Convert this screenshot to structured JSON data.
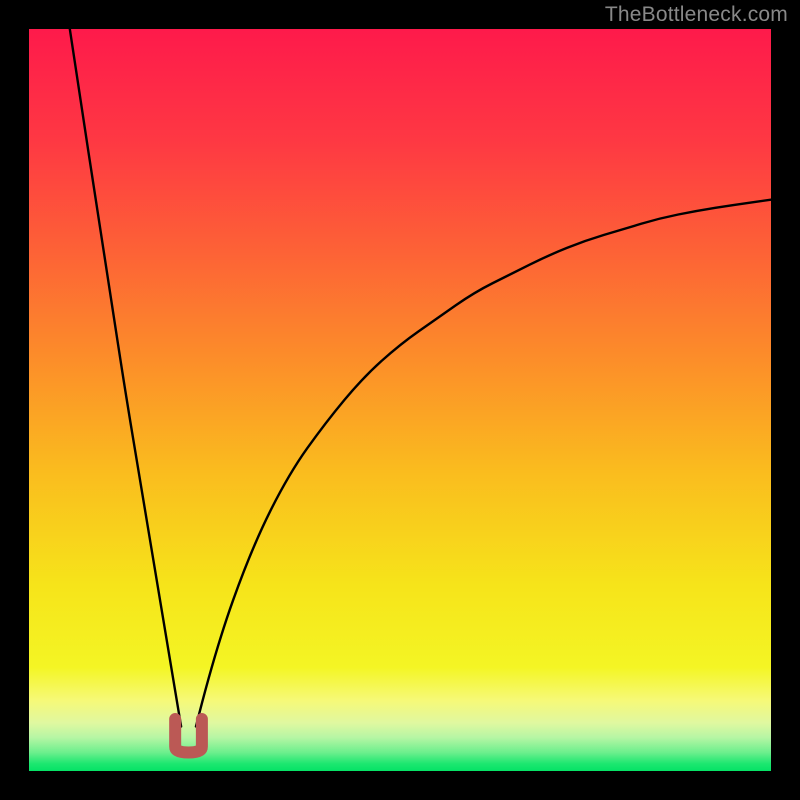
{
  "watermark": "TheBottleneck.com",
  "chart_data": {
    "type": "line",
    "title": "",
    "xlabel": "",
    "ylabel": "",
    "xlim": [
      0,
      1
    ],
    "ylim": [
      0,
      1
    ],
    "x_minimum": 0.215,
    "min_value": 0.03,
    "left_start_y": 1.0,
    "right_end_y": 0.77,
    "series": [
      {
        "name": "left-branch",
        "x": [
          0.055,
          0.07,
          0.09,
          0.11,
          0.13,
          0.15,
          0.17,
          0.19,
          0.205
        ],
        "y": [
          1.0,
          0.9,
          0.77,
          0.64,
          0.51,
          0.39,
          0.27,
          0.15,
          0.06
        ]
      },
      {
        "name": "right-branch",
        "x": [
          0.225,
          0.25,
          0.3,
          0.35,
          0.4,
          0.45,
          0.5,
          0.55,
          0.6,
          0.65,
          0.7,
          0.75,
          0.8,
          0.85,
          0.9,
          0.95,
          1.0
        ],
        "y": [
          0.06,
          0.16,
          0.3,
          0.4,
          0.47,
          0.53,
          0.575,
          0.61,
          0.645,
          0.67,
          0.695,
          0.715,
          0.73,
          0.745,
          0.755,
          0.763,
          0.77
        ]
      }
    ],
    "marker": {
      "name": "bottom-u-marker",
      "x_range": [
        0.197,
        0.233
      ],
      "y_range": [
        0.025,
        0.07
      ],
      "color": "#bb5955"
    },
    "background": {
      "type": "vertical-gradient",
      "stops": [
        {
          "pos": 0.0,
          "color": "#fe1a4b"
        },
        {
          "pos": 0.15,
          "color": "#fe3843"
        },
        {
          "pos": 0.3,
          "color": "#fd6236"
        },
        {
          "pos": 0.45,
          "color": "#fc8f29"
        },
        {
          "pos": 0.6,
          "color": "#fabd1e"
        },
        {
          "pos": 0.75,
          "color": "#f6e41a"
        },
        {
          "pos": 0.86,
          "color": "#f4f524"
        },
        {
          "pos": 0.905,
          "color": "#f6f978"
        },
        {
          "pos": 0.935,
          "color": "#e0f8a0"
        },
        {
          "pos": 0.955,
          "color": "#b6f6a4"
        },
        {
          "pos": 0.975,
          "color": "#6cef8d"
        },
        {
          "pos": 0.99,
          "color": "#1de770"
        },
        {
          "pos": 1.0,
          "color": "#05e266"
        }
      ]
    }
  }
}
